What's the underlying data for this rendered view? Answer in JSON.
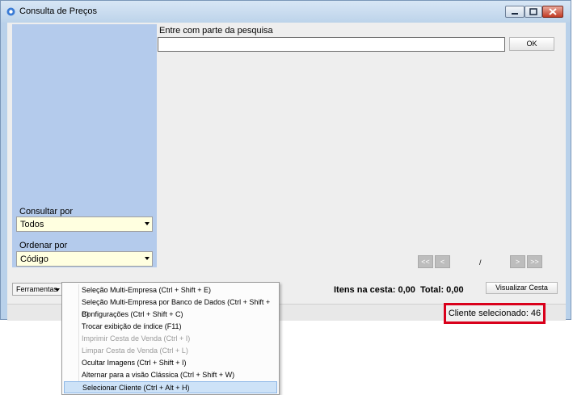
{
  "window": {
    "title": "Consulta de Preços"
  },
  "search": {
    "label": "Entre com parte da pesquisa",
    "value": "",
    "ok_label": "OK"
  },
  "filters": {
    "consultar_label": "Consultar por",
    "consultar_value": "Todos",
    "ordenar_label": "Ordenar por",
    "ordenar_value": "Código"
  },
  "pagination": {
    "first": "<<",
    "prev": "<",
    "page_text": "/",
    "next": ">",
    "last": ">>"
  },
  "bottom": {
    "tools_label": "Ferramentas",
    "cart_items_label": "Itens na cesta: 0,00",
    "cart_total_label": "Total: 0,00",
    "view_cart_label": "Visualizar Cesta"
  },
  "status": {
    "client_selected": "Cliente selecionado: 46"
  },
  "menu": {
    "items": [
      {
        "label": "Seleção Multi-Empresa (Ctrl + Shift + E)",
        "state": "enabled"
      },
      {
        "label": "Seleção Multi-Empresa por Banco de Dados (Ctrl + Shift + B)",
        "state": "enabled"
      },
      {
        "label": "Configurações (Ctrl + Shift + C)",
        "state": "enabled"
      },
      {
        "label": "Trocar exibição de índice (F11)",
        "state": "enabled"
      },
      {
        "label": "Imprimir Cesta de Venda (Ctrl + I)",
        "state": "disabled"
      },
      {
        "label": "Limpar Cesta de Venda (Ctrl + L)",
        "state": "disabled"
      },
      {
        "label": "Ocultar Imagens (Ctrl + Shift + I)",
        "state": "enabled"
      },
      {
        "label": "Alternar para a visão Clássica (Ctrl + Shift + W)",
        "state": "enabled"
      },
      {
        "label": "Selecionar Cliente (Ctrl + Alt + H)",
        "state": "selected"
      }
    ]
  },
  "colors": {
    "left_panel": "#b4cbec",
    "combo_bg": "#ffffe0",
    "highlight_border": "#d9001b",
    "menu_selected": "#cde2f7"
  }
}
